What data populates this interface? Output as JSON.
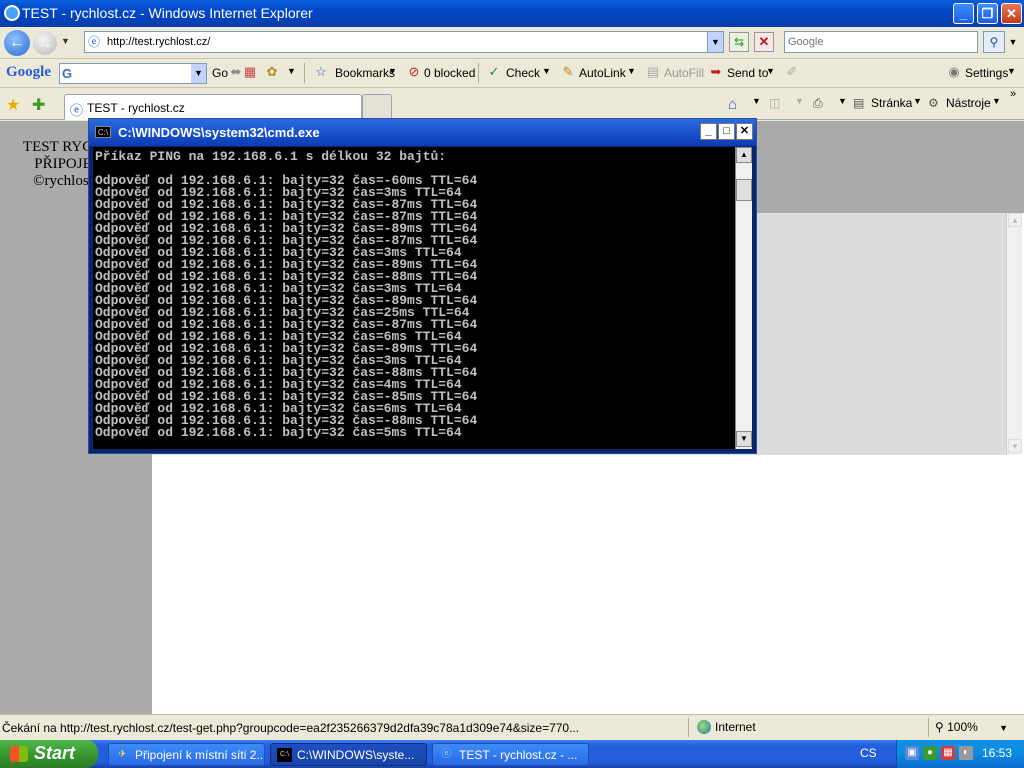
{
  "ie": {
    "title": "TEST - rychlost.cz - Windows Internet Explorer",
    "address": "http://test.rychlost.cz/",
    "search_placeholder": "Google",
    "google_toolbar": {
      "logo": "Google",
      "go": "Go",
      "bookmarks": "Bookmarks",
      "blocked": "0 blocked",
      "check": "Check",
      "autolink": "AutoLink",
      "autofill": "AutoFill",
      "sendto": "Send to",
      "settings": "Settings"
    },
    "tab_label": "TEST - rychlost.cz",
    "commands": {
      "page": "Stránka",
      "tools": "Nástroje"
    }
  },
  "page": {
    "heading_lines": [
      "TEST RYCH",
      "PŘIPOJE",
      "©rychlost"
    ]
  },
  "cmd": {
    "title": "C:\\WINDOWS\\system32\\cmd.exe",
    "header": "Příkaz PING na 192.168.6.1 s délkou 32 bajtů:",
    "reply_prefix": "Odpověď od 192.168.6.1: bajty=32 čas=",
    "replies": [
      {
        "time": "-60ms",
        "ttl": "64"
      },
      {
        "time": "3ms",
        "ttl": "64"
      },
      {
        "time": "-87ms",
        "ttl": "64"
      },
      {
        "time": "-87ms",
        "ttl": "64"
      },
      {
        "time": "-89ms",
        "ttl": "64"
      },
      {
        "time": "-87ms",
        "ttl": "64"
      },
      {
        "time": "3ms",
        "ttl": "64"
      },
      {
        "time": "-89ms",
        "ttl": "64"
      },
      {
        "time": "-88ms",
        "ttl": "64"
      },
      {
        "time": "3ms",
        "ttl": "64"
      },
      {
        "time": "-89ms",
        "ttl": "64"
      },
      {
        "time": "25ms",
        "ttl": "64"
      },
      {
        "time": "-87ms",
        "ttl": "64"
      },
      {
        "time": "6ms",
        "ttl": "64"
      },
      {
        "time": "-89ms",
        "ttl": "64"
      },
      {
        "time": "3ms",
        "ttl": "64"
      },
      {
        "time": "-88ms",
        "ttl": "64"
      },
      {
        "time": "4ms",
        "ttl": "64"
      },
      {
        "time": "-85ms",
        "ttl": "64"
      },
      {
        "time": "6ms",
        "ttl": "64"
      },
      {
        "time": "-88ms",
        "ttl": "64"
      },
      {
        "time": "5ms",
        "ttl": "64"
      }
    ]
  },
  "status": {
    "text": "Čekání na http://test.rychlost.cz/test-get.php?groupcode=ea2f235266379d2dfa39c78a1d309e74&size=770...",
    "zone": "Internet",
    "zoom": "100%"
  },
  "taskbar": {
    "start": "Start",
    "tasks": [
      {
        "label": "Připojení k místní síti 2...",
        "icon": "network-icon"
      },
      {
        "label": "C:\\WINDOWS\\syste...",
        "icon": "cmd-icon"
      },
      {
        "label": "TEST - rychlost.cz - ...",
        "icon": "ie-icon"
      }
    ],
    "language": "CS",
    "clock": "16:53"
  }
}
